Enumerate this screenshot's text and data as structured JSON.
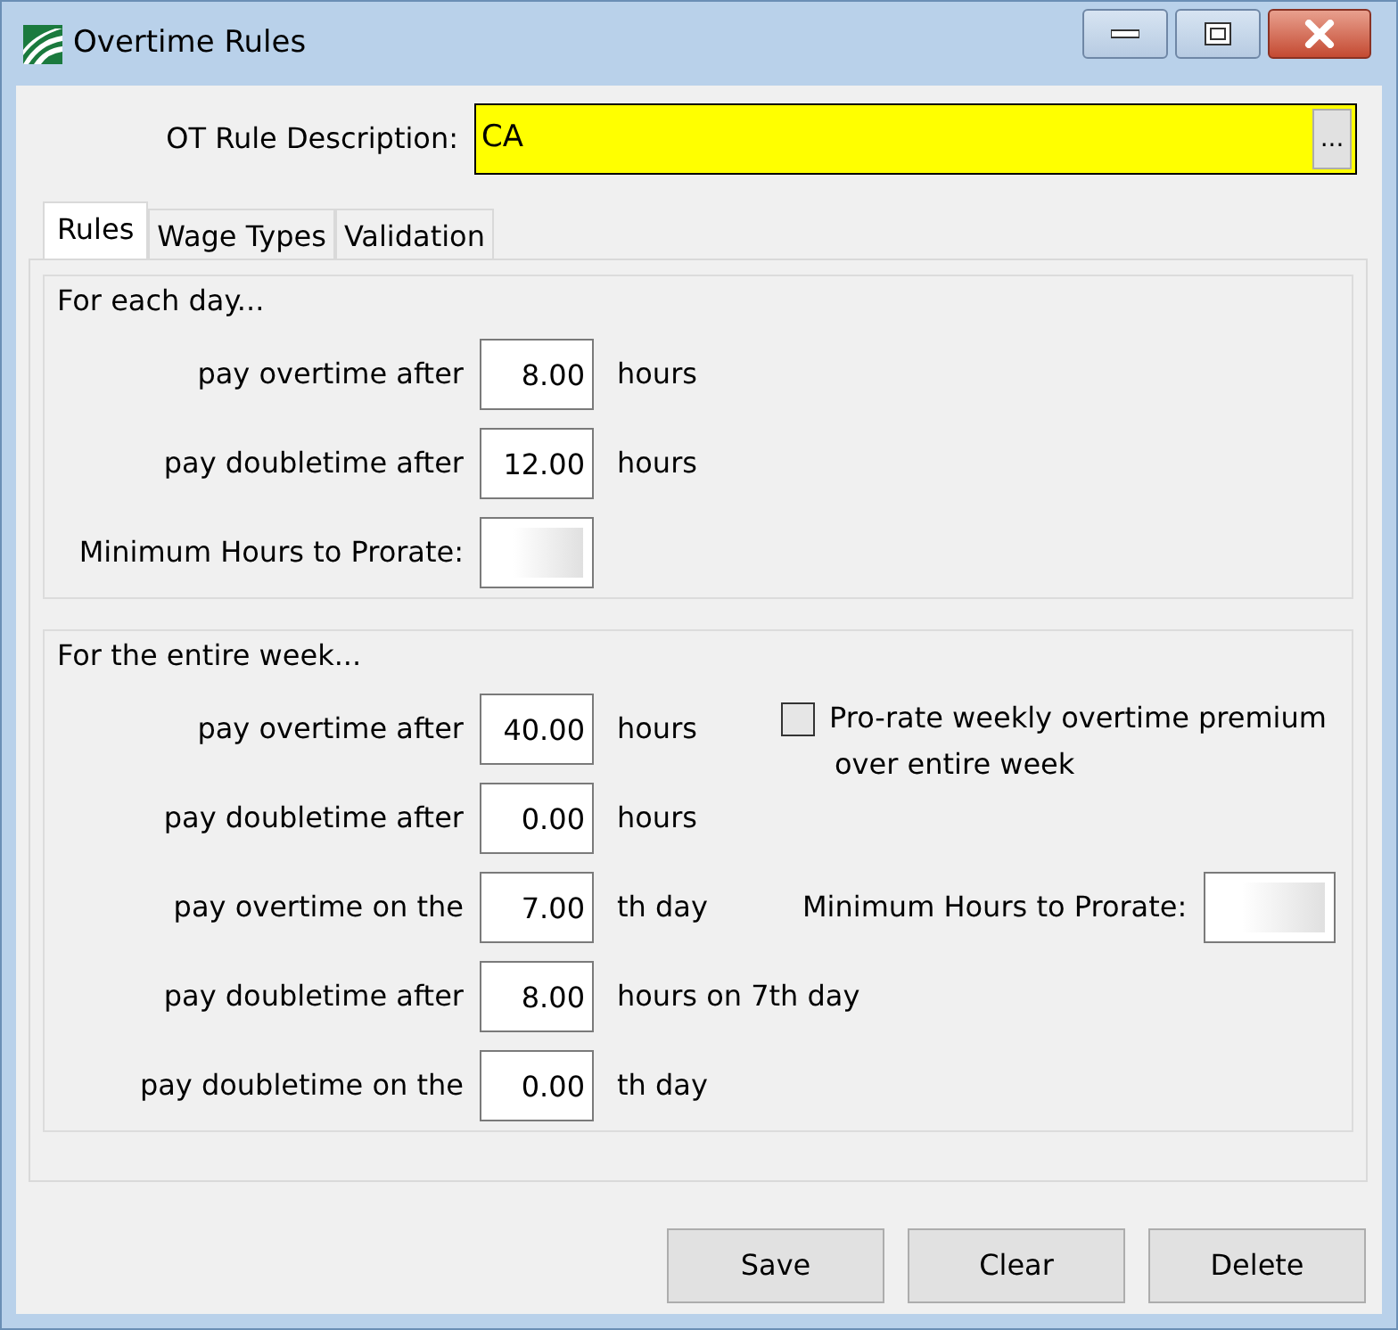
{
  "window": {
    "title": "Overtime Rules"
  },
  "description": {
    "label": "OT Rule Description:",
    "value": "CA",
    "button": "..."
  },
  "tabs": [
    {
      "label": "Rules",
      "selected": true
    },
    {
      "label": "Wage Types",
      "selected": false
    },
    {
      "label": "Validation",
      "selected": false
    }
  ],
  "sections": [
    {
      "title": "For each day...",
      "rows": [
        {
          "label": "pay overtime after",
          "value": "8.00",
          "unit": "hours"
        },
        {
          "label": "pay doubletime after",
          "value": "12.00",
          "unit": "hours"
        },
        {
          "label": "Minimum Hours to Prorate:"
        }
      ]
    },
    {
      "title": "For the entire week...",
      "rows": [
        {
          "label": "pay overtime after",
          "value": "40.00",
          "unit": "hours",
          "side": {
            "kind": "checkbox",
            "label": "Pro-rate weekly overtime premium",
            "label2": "over entire week",
            "checked": false
          }
        },
        {
          "label": "pay doubletime after",
          "value": "0.00",
          "unit": "hours"
        },
        {
          "label": "pay overtime on the",
          "value": "7.00",
          "unit": "th day",
          "side": {
            "kind": "field",
            "label": "Minimum Hours to Prorate:"
          }
        },
        {
          "label": "pay doubletime after",
          "value": "8.00",
          "unit": "hours on 7th day"
        },
        {
          "label": "pay doubletime on the",
          "value": "0.00",
          "unit": "th day"
        }
      ]
    }
  ],
  "buttons": [
    "Save",
    "Clear",
    "Delete"
  ]
}
